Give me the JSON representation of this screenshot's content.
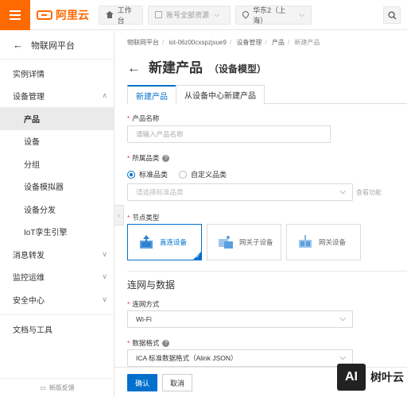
{
  "topbar": {
    "logo_text": "阿里云",
    "workbench": "工作台",
    "account_resources": "账号全部资源",
    "region": "华东2（上海）"
  },
  "sidebar": {
    "back_label": "物联网平台",
    "items": [
      {
        "label": "实例详情"
      },
      {
        "label": "设备管理",
        "caret": "∧"
      },
      {
        "label": "产品",
        "active": true
      },
      {
        "label": "设备"
      },
      {
        "label": "分组"
      },
      {
        "label": "设备模拟器"
      },
      {
        "label": "设备分发"
      },
      {
        "label": "IoT孪生引擎"
      },
      {
        "label": "消息转发",
        "caret": "∨"
      },
      {
        "label": "监控运维",
        "caret": "∨"
      },
      {
        "label": "安全中心",
        "caret": "∨"
      },
      {
        "label": "文档与工具"
      }
    ],
    "feedback": "新版反馈"
  },
  "breadcrumb": [
    "物联网平台",
    "iot-06z00cxspzjxue9",
    "设备管理",
    "产品",
    "新建产品"
  ],
  "page": {
    "title": "新建产品",
    "subtitle": "（设备模型）"
  },
  "tabs": [
    {
      "label": "新建产品",
      "active": true
    },
    {
      "label": "从设备中心新建产品"
    }
  ],
  "form": {
    "product_name_label": "产品名称",
    "product_name_placeholder": "请输入产品名称",
    "category_label": "所属品类",
    "category_options": [
      "标准品类",
      "自定义品类"
    ],
    "category_selected": "标准品类",
    "category_select_placeholder": "请选择标准品类",
    "view_functions_link": "查看功能",
    "node_type_label": "节点类型",
    "node_types": [
      {
        "label": "直连设备",
        "active": true
      },
      {
        "label": "网关子设备"
      },
      {
        "label": "网关设备"
      }
    ],
    "network_section": "连网与数据",
    "network_method_label": "连网方式",
    "network_method_value": "Wi-Fi",
    "data_format_label": "数据格式",
    "data_format_value": "ICA 标准数据格式（Alink JSON）"
  },
  "footer": {
    "confirm": "确认",
    "cancel": "取消"
  },
  "watermark": {
    "box": "AI",
    "text": "树叶云"
  },
  "colors": {
    "brand": "#ff6a00",
    "primary": "#0070cc",
    "required": "#e84040"
  }
}
